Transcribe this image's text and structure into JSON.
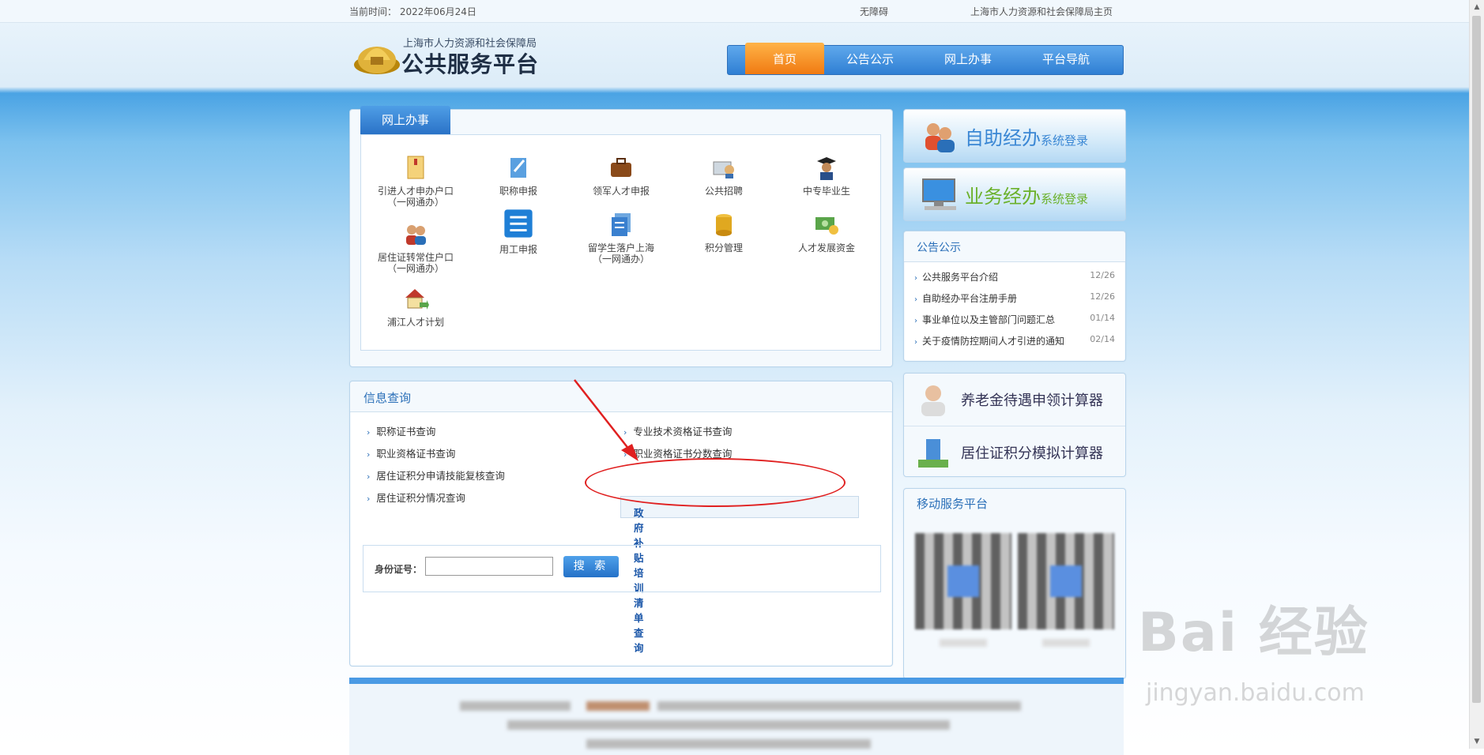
{
  "topbar": {
    "date": "当前时间： 2022年06月24日",
    "accessibility": "无障碍",
    "home_link": "上海市人力资源和社会保障局主页"
  },
  "logo": {
    "line1": "上海市人力资源和社会保障局",
    "line2": "公共服务平台"
  },
  "nav": {
    "items": [
      "首页",
      "公告公示",
      "网上办事",
      "平台导航"
    ],
    "active": "首页"
  },
  "services": {
    "tab": "网上办事",
    "items": [
      {
        "label": "引进人才申办户口",
        "sub": "（一网通办）",
        "icon": "folder-icon"
      },
      {
        "label": "职称申报",
        "sub": "",
        "icon": "pen-doc-icon"
      },
      {
        "label": "领军人才申报",
        "sub": "",
        "icon": "briefcase-icon"
      },
      {
        "label": "公共招聘",
        "sub": "",
        "icon": "recruit-icon"
      },
      {
        "label": "中专毕业生",
        "sub": "",
        "icon": "graduate-icon"
      },
      {
        "label": "居住证转常住户口",
        "sub": "（一网通办）",
        "icon": "people-icon"
      },
      {
        "label": "用工申报",
        "sub": "",
        "icon": "list-icon"
      },
      {
        "label": "留学生落户上海",
        "sub": "（一网通办）",
        "icon": "documents-icon"
      },
      {
        "label": "积分管理",
        "sub": "",
        "icon": "coins-icon"
      },
      {
        "label": "人才发展资金",
        "sub": "",
        "icon": "money-icon"
      },
      {
        "label": "浦江人才计划",
        "sub": "",
        "icon": "house-icon"
      }
    ]
  },
  "info": {
    "title": "信息查询",
    "left": [
      "职称证书查询",
      "职业资格证书查询",
      "居住证积分申请技能复核查询",
      "居住证积分情况查询"
    ],
    "right": [
      "专业技术资格证书查询",
      "职业资格证书分数查询"
    ],
    "highlight": "政府补贴培训清单查询",
    "id_label": "身份证号：",
    "search_button": "搜 索"
  },
  "banners": {
    "self_main": "自助经办",
    "self_sub": "系统登录",
    "biz_main": "业务经办",
    "biz_sub": "系统登录"
  },
  "notice": {
    "title": "公告公示",
    "items": [
      {
        "text": "公共服务平台介绍",
        "date": "12/26"
      },
      {
        "text": "自助经办平台注册手册",
        "date": "12/26"
      },
      {
        "text": "事业单位以及主管部门问题汇总",
        "date": "01/14"
      },
      {
        "text": "关于疫情防控期间人才引进的通知",
        "date": "02/14"
      }
    ]
  },
  "calc": {
    "pension": "养老金待遇申领计算器",
    "points": "居住证积分模拟计算器"
  },
  "mobile": {
    "title": "移动服务平台"
  },
  "watermark": {
    "main": "Bai 经验",
    "sub": "jingyan.baidu.com"
  },
  "colors": {
    "brand_blue": "#2a72c7",
    "nav_active": "#f07a12",
    "annotation_red": "#e02020"
  }
}
